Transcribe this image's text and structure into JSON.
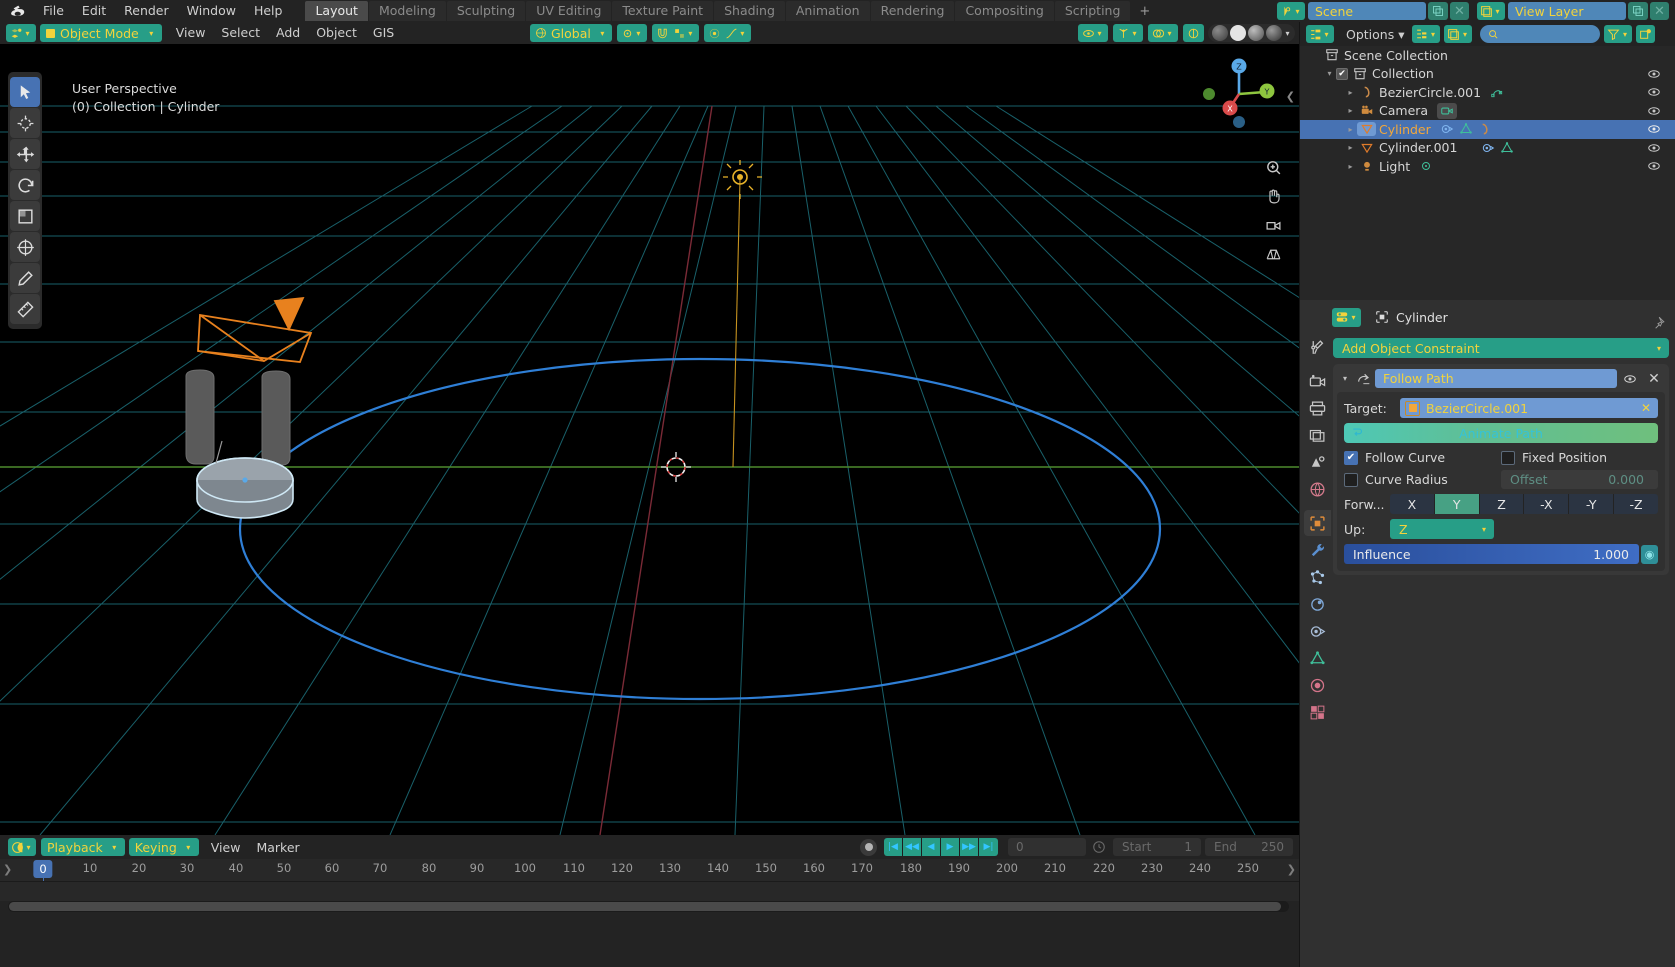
{
  "app": {
    "name": "Blender",
    "logo_icon": "blender-logo"
  },
  "topbar": {
    "menus": [
      "File",
      "Edit",
      "Render",
      "Window",
      "Help"
    ],
    "workspaces": [
      {
        "label": "Layout",
        "active": true
      },
      {
        "label": "Modeling",
        "active": false
      },
      {
        "label": "Sculpting",
        "active": false
      },
      {
        "label": "UV Editing",
        "active": false
      },
      {
        "label": "Texture Paint",
        "active": false
      },
      {
        "label": "Shading",
        "active": false
      },
      {
        "label": "Animation",
        "active": false
      },
      {
        "label": "Rendering",
        "active": false
      },
      {
        "label": "Compositing",
        "active": false
      },
      {
        "label": "Scripting",
        "active": false
      }
    ],
    "add_workspace_label": "+",
    "scene": {
      "icon": "scene-icon",
      "value": "Scene",
      "new_icon": "duplicate-icon",
      "unlink_icon": "close-icon"
    },
    "view_layer": {
      "icon": "view-layer-icon",
      "value": "View Layer",
      "new_icon": "duplicate-icon",
      "unlink_icon": "close-icon"
    }
  },
  "viewport_header": {
    "editor_icon": "editor-type-3dview-icon",
    "mode": "Object Mode",
    "menus": [
      "View",
      "Select",
      "Add",
      "Object",
      "GIS"
    ],
    "transform_orientation": "Global",
    "snap_icon": "magnet-icon",
    "proportional_icon": "proportional-edit-icon",
    "select_modes": [
      "tweak",
      "box",
      "circle",
      "lasso"
    ],
    "visibility_icon": "eye-icon",
    "gizmo_icon": "gizmo-icon",
    "overlays_icon": "overlays-icon",
    "xray_icon": "xray-icon",
    "shading_modes": [
      "wireframe",
      "solid",
      "material-preview",
      "rendered"
    ],
    "active_shading": "solid"
  },
  "toolbar": {
    "tools": [
      {
        "name": "tweak-tool",
        "icon": "cursor-arrow-icon",
        "active": true
      },
      {
        "name": "cursor-tool",
        "icon": "3d-cursor-icon",
        "active": false
      },
      {
        "name": "move-tool",
        "icon": "move-arrows-icon",
        "active": false
      },
      {
        "name": "rotate-tool",
        "icon": "rotate-icon",
        "active": false
      },
      {
        "name": "scale-tool",
        "icon": "scale-icon",
        "active": false
      },
      {
        "name": "transform-tool",
        "icon": "transform-icon",
        "active": false
      },
      {
        "name": "annotate-tool",
        "icon": "pencil-icon",
        "active": false
      },
      {
        "name": "measure-tool",
        "icon": "ruler-icon",
        "active": false
      }
    ]
  },
  "viewport": {
    "perspective_label": "User Perspective",
    "scene_label": "(0) Collection | Cylinder",
    "gizmo_axes": [
      "Z",
      "Y",
      "X"
    ],
    "side_buttons": [
      "zoom-icon",
      "pan-hand-icon",
      "camera-view-icon",
      "ortho-persp-icon"
    ],
    "collapse_icon": "chevron-left-icon"
  },
  "outliner": {
    "display_mode_icon": "outliner-icon",
    "filter_icon": "filter-funnel-icon",
    "new_collection_icon": "new-collection-icon",
    "view_layer_icon": "view-layer-icon",
    "search_placeholder": "",
    "search_icon": "search-icon",
    "rows": [
      {
        "label": "Scene Collection",
        "icon": "collection-icon",
        "indent": 0,
        "active": false,
        "checkbox": false,
        "disclosure": false,
        "badges": [],
        "eye": false
      },
      {
        "label": "Collection",
        "icon": "collection-icon",
        "indent": 1,
        "active": false,
        "checkbox": true,
        "disclosure": true,
        "badges": [],
        "eye": true
      },
      {
        "label": "BezierCircle.001",
        "icon": "curve-icon",
        "indent": 2,
        "active": false,
        "checkbox": false,
        "disclosure": true,
        "badges": [
          "curve-data-icon"
        ],
        "eye": true
      },
      {
        "label": "Camera",
        "icon": "camera-icon",
        "indent": 2,
        "active": false,
        "checkbox": false,
        "disclosure": true,
        "badges": [
          "camera-data-icon"
        ],
        "eye": true
      },
      {
        "label": "Cylinder",
        "icon": "mesh-cone-icon",
        "indent": 2,
        "active": true,
        "checkbox": false,
        "disclosure": true,
        "badges": [
          "constraint-icon",
          "mesh-data-icon",
          "curve-data-icon"
        ],
        "eye": true
      },
      {
        "label": "Cylinder.001",
        "icon": "mesh-cone-icon",
        "indent": 2,
        "active": false,
        "checkbox": false,
        "disclosure": true,
        "badges": [
          "constraint-icon",
          "mesh-data-icon"
        ],
        "eye": true
      },
      {
        "label": "Light",
        "icon": "light-icon",
        "indent": 2,
        "active": false,
        "checkbox": false,
        "disclosure": true,
        "badges": [
          "light-data-icon"
        ],
        "eye": true
      }
    ]
  },
  "properties": {
    "editor_icon": "properties-editor-icon",
    "breadcrumb_icon": "object-icon",
    "breadcrumb": "Cylinder",
    "pin_icon": "pin-icon",
    "tabs": [
      {
        "name": "tool",
        "icon": "tool-icon",
        "active": false
      },
      {
        "name": "render",
        "icon": "render-camera-icon",
        "active": false
      },
      {
        "name": "output",
        "icon": "printer-icon",
        "active": false
      },
      {
        "name": "view-layer",
        "icon": "images-icon",
        "active": false
      },
      {
        "name": "scene",
        "icon": "scene-cone-icon",
        "active": false
      },
      {
        "name": "world",
        "icon": "world-globe-icon",
        "active": false
      },
      {
        "name": "object",
        "icon": "object-square-icon",
        "active": true
      },
      {
        "name": "modifiers",
        "icon": "wrench-icon",
        "active": false
      },
      {
        "name": "particles",
        "icon": "particles-icon",
        "active": false
      },
      {
        "name": "physics",
        "icon": "physics-orbit-icon",
        "active": false
      },
      {
        "name": "object-constraints",
        "icon": "constraint-icon",
        "active": false
      },
      {
        "name": "object-data",
        "icon": "mesh-data-icon",
        "active": false
      },
      {
        "name": "material",
        "icon": "material-sphere-icon",
        "active": false
      },
      {
        "name": "texture",
        "icon": "texture-checker-icon",
        "active": false
      }
    ],
    "add_constraint_label": "Add Object Constraint",
    "constraint": {
      "expand_icon": "triangle-down-icon",
      "type_icon": "follow-path-icon",
      "name": "Follow Path",
      "visibility_icon": "eye-icon",
      "delete_icon": "close-icon",
      "target_label": "Target:",
      "target_value": "BezierCircle.001",
      "target_clear_icon": "close-icon",
      "animate_path_label": "Animate Path",
      "animate_path_icon": "animate-path-icon",
      "follow_curve_label": "Follow Curve",
      "follow_curve_checked": true,
      "fixed_position_label": "Fixed Position",
      "fixed_position_checked": false,
      "curve_radius_label": "Curve Radius",
      "curve_radius_checked": false,
      "offset_label": "Offset",
      "offset_value": "0.000",
      "forward_label": "Forw...",
      "forward_axes": [
        "X",
        "Y",
        "Z",
        "-X",
        "-Y",
        "-Z"
      ],
      "forward_active": "Y",
      "up_label": "Up:",
      "up_value": "Z",
      "influence_label": "Influence",
      "influence_value": "1.000",
      "influence_anim_icon": "animate-decorator-icon"
    }
  },
  "timeline": {
    "editor_icon": "timeline-editor-icon",
    "playback_label": "Playback",
    "keying_label": "Keying",
    "menus": [
      "View",
      "Marker"
    ],
    "auto_key_icon": "record-dot-icon",
    "transport_buttons": [
      "jump-start-icon",
      "prev-keyframe-icon",
      "play-reverse-icon",
      "play-icon",
      "next-keyframe-icon",
      "jump-end-icon"
    ],
    "current_frame_value": "0",
    "current_frame_icon": "clock-icon",
    "start_label": "Start",
    "start_value": "1",
    "end_label": "End",
    "end_value": "250",
    "playhead_frame": "0",
    "ticks": [
      "0",
      "10",
      "20",
      "30",
      "40",
      "50",
      "60",
      "70",
      "80",
      "90",
      "100",
      "110",
      "120",
      "130",
      "140",
      "150",
      "160",
      "170",
      "180",
      "190",
      "200",
      "210",
      "220",
      "230",
      "240",
      "250"
    ]
  },
  "colors": {
    "accent_teal": "#279e87",
    "accent_yellow": "#f2d33c",
    "select_blue": "#4772b3",
    "field_blue": "#6f9ad3",
    "orange_active": "#f2a73b",
    "bg_dark": "#232323",
    "bg_panel": "#303030",
    "curve_blue": "#2f7fd6",
    "grid_teal": "#1e6d78"
  }
}
